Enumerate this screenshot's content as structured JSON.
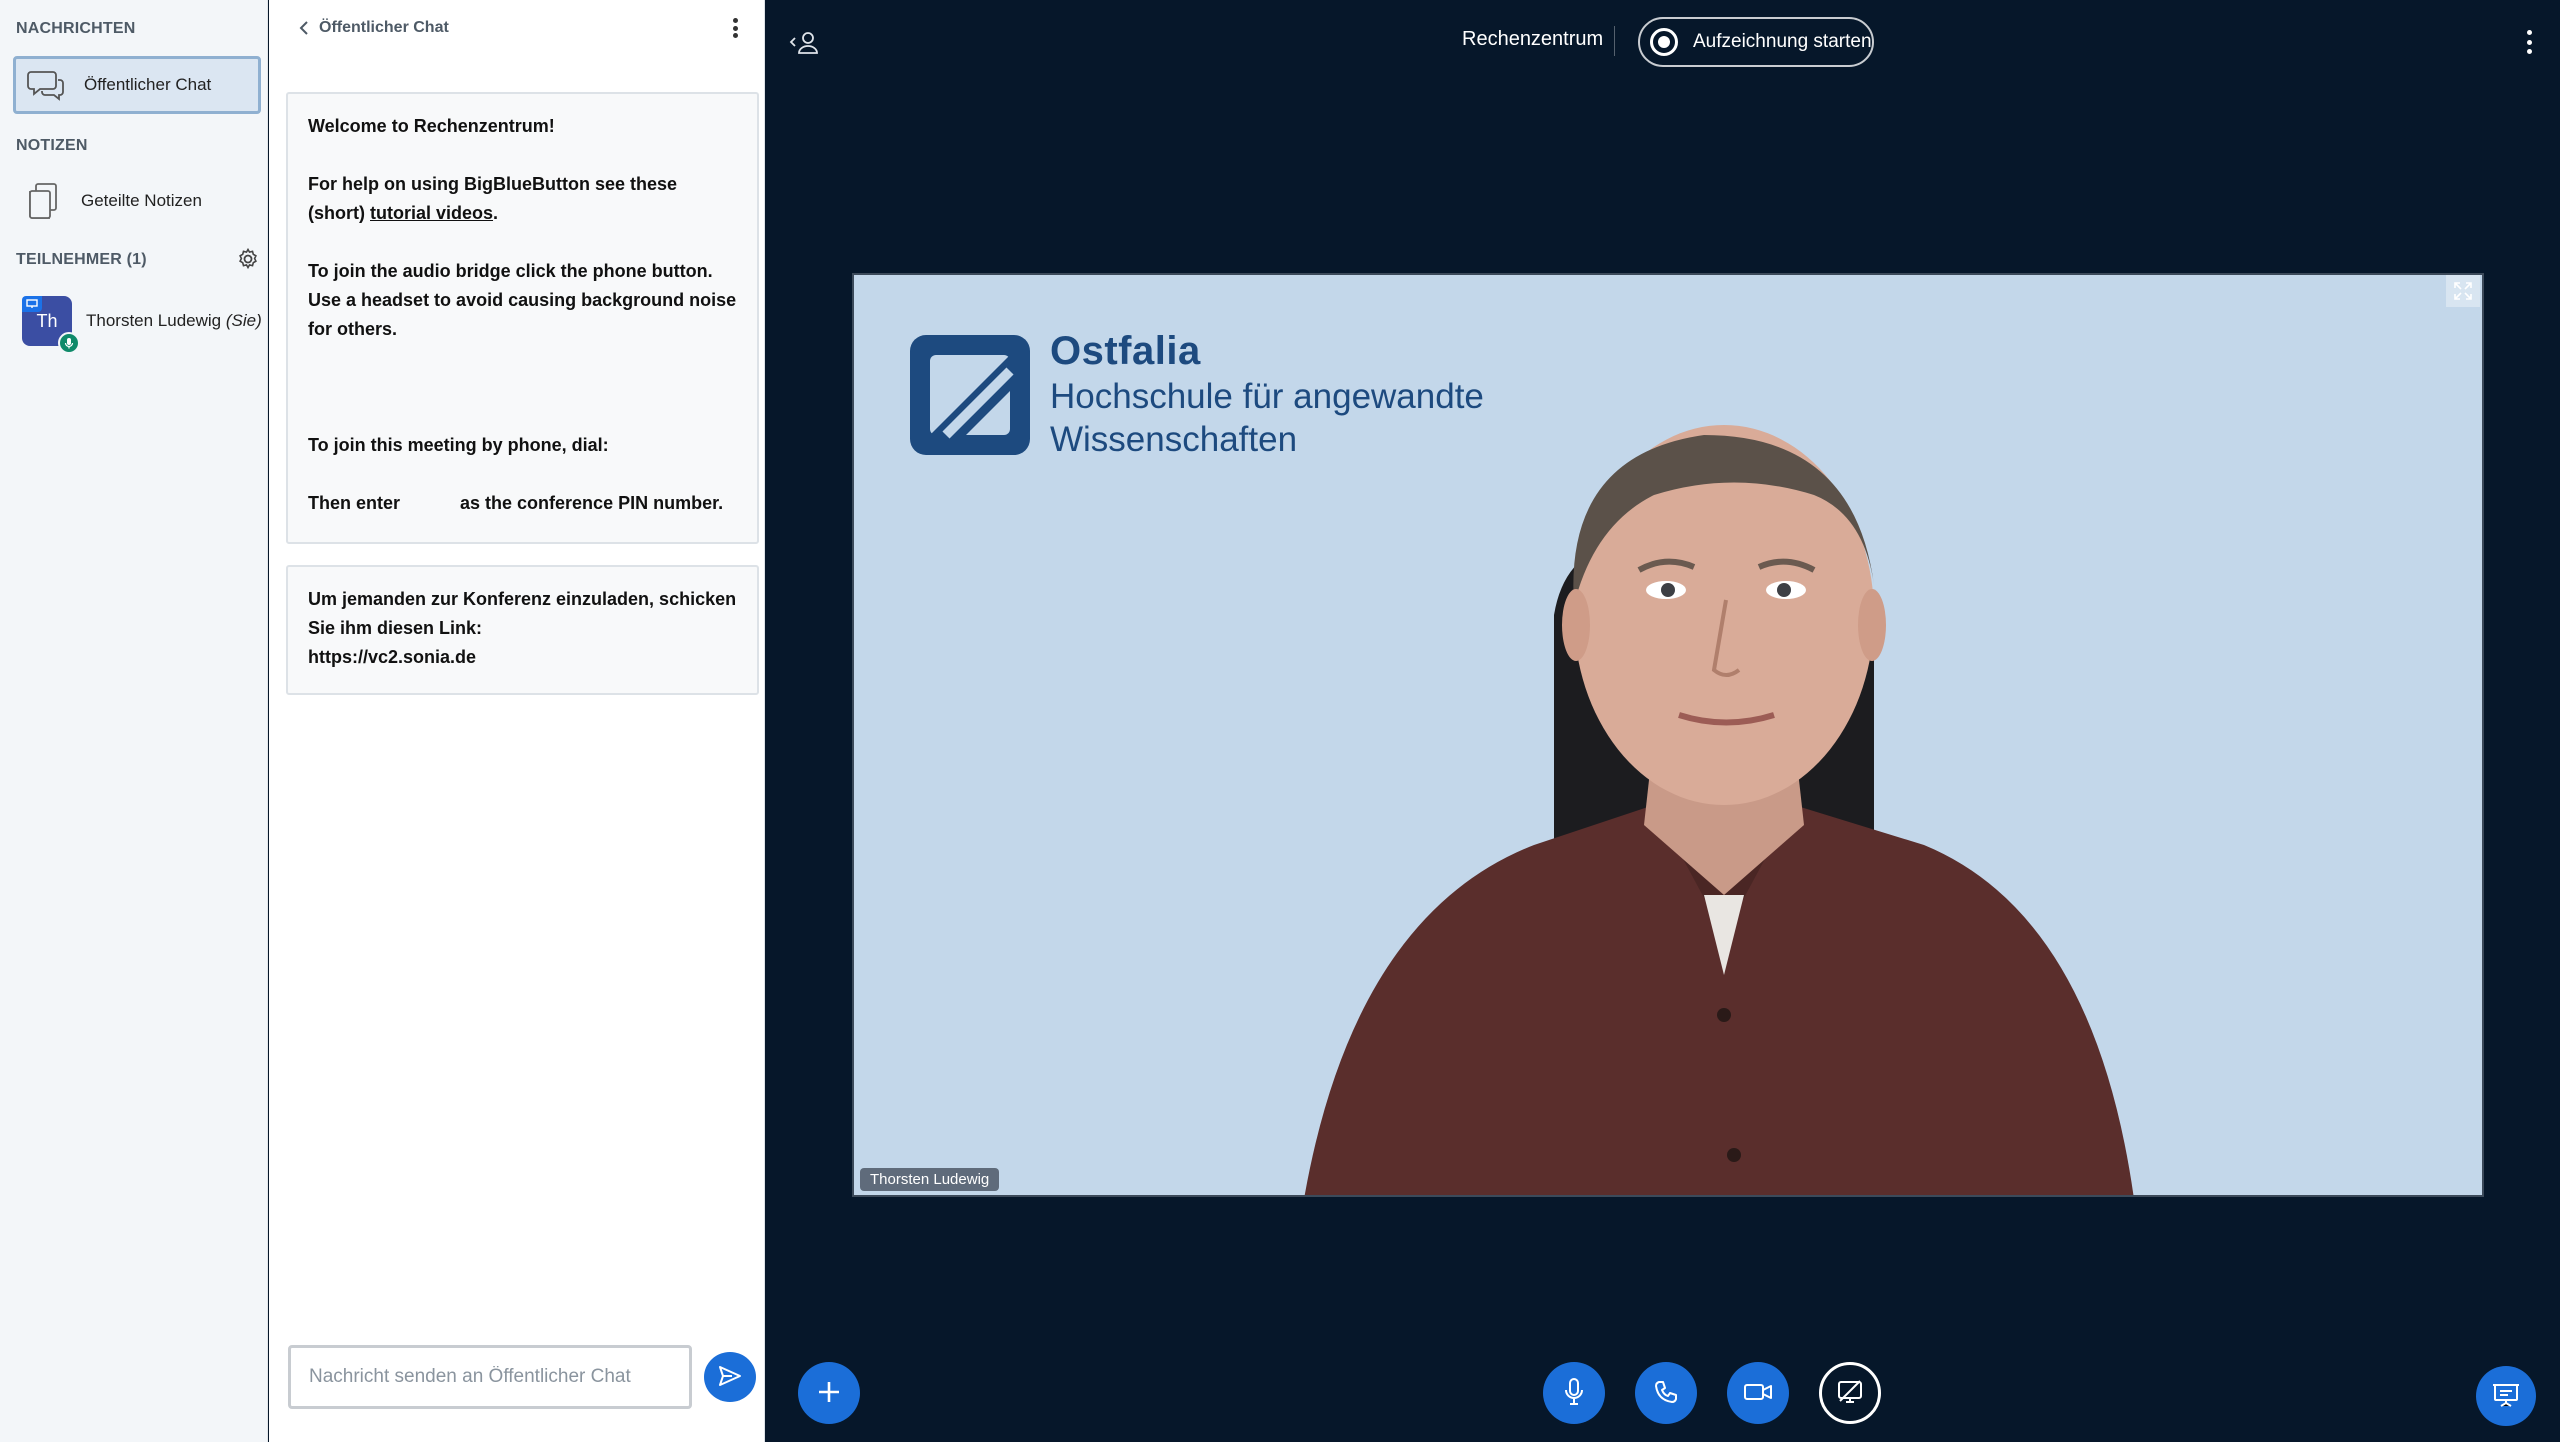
{
  "sidebar": {
    "messages_title": "NACHRICHTEN",
    "public_chat_label": "Öffentlicher Chat",
    "notes_title": "NOTIZEN",
    "shared_notes_label": "Geteilte Notizen",
    "participants_title": "TEILNEHMER (1)",
    "user": {
      "initials": "Th",
      "name": "Thorsten Ludewig",
      "you_suffix": "(Sie)"
    }
  },
  "chat": {
    "title": "Öffentlicher Chat",
    "welcome": {
      "line1_prefix": "Welcome to ",
      "line1_name": "Rechenzentrum",
      "line1_suffix": "!",
      "help_prefix": "For help on using BigBlueButton see these (short) ",
      "help_link": "tutorial videos",
      "help_suffix": ".",
      "audio": "To join the audio bridge click the phone button. Use a headset to avoid causing background noise for others.",
      "phone": "To join this meeting by phone, dial:",
      "pin_prefix": "Then enter",
      "pin_suffix": "as the conference PIN number."
    },
    "invite_text": "Um jemanden zur Konferenz einzuladen, schicken Sie ihm diesen Link:",
    "invite_link": "https://vc2.sonia.de",
    "input_placeholder": "Nachricht senden an Öffentlicher Chat"
  },
  "header": {
    "meeting_name": "Rechenzentrum",
    "record_label": "Aufzeichnung starten"
  },
  "video": {
    "brand": "Ostfalia",
    "brand_sub1": "Hochschule für angewandte",
    "brand_sub2": "Wissenschaften",
    "participant_label": "Thorsten Ludewig"
  },
  "colors": {
    "primary": "#1b6ed8",
    "background": "#06172a",
    "sidebar": "#f3f6f9",
    "video_bg": "#c3d7ea",
    "brand": "#1d4a7f"
  },
  "icons": {
    "chat": "chat-bubbles-icon",
    "notes": "document-icon",
    "settings": "gear-icon",
    "back": "chevron-left-icon",
    "users_toggle": "user-toggle-icon",
    "record": "record-icon",
    "fullscreen": "fullscreen-icon",
    "plus": "plus-icon",
    "mic": "microphone-icon",
    "phone": "phone-icon",
    "camera": "camera-icon",
    "screenshare": "screenshare-off-icon",
    "presentation": "presentation-icon",
    "send": "send-icon"
  }
}
